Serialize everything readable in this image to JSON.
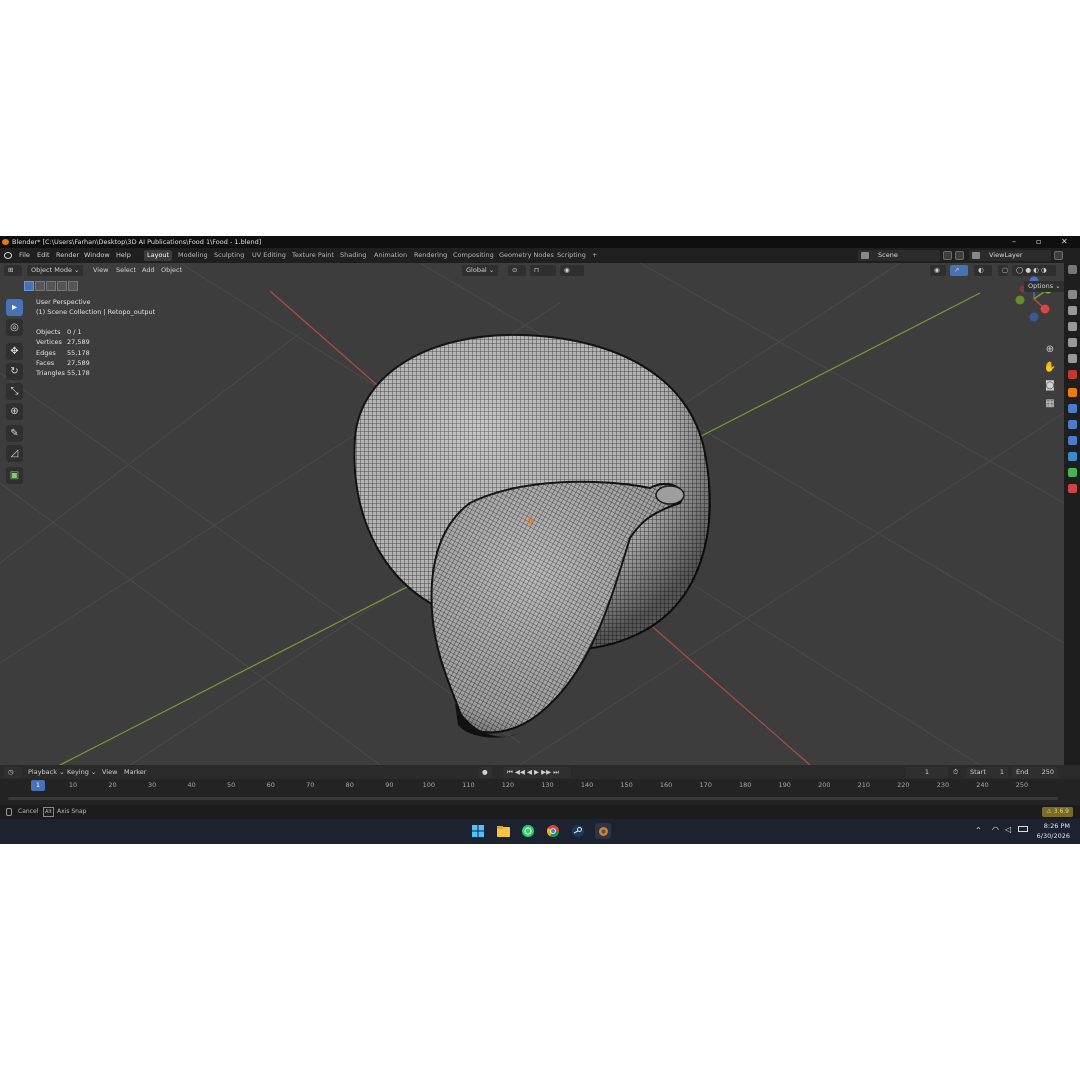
{
  "window": {
    "title": "Blender* [C:\\Users\\Farhan\\Desktop\\3D AI Publications\\Food 1\\Food - 1.blend]"
  },
  "menu": {
    "items": [
      "File",
      "Edit",
      "Render",
      "Window",
      "Help"
    ]
  },
  "workspaces": [
    "Layout",
    "Modeling",
    "Sculpting",
    "UV Editing",
    "Texture Paint",
    "Shading",
    "Animation",
    "Rendering",
    "Compositing",
    "Geometry Nodes",
    "Scripting",
    "+"
  ],
  "scene": {
    "scene_name": "Scene",
    "view_layer": "ViewLayer"
  },
  "viewport_header": {
    "mode": "Object Mode",
    "menus": [
      "View",
      "Select",
      "Add",
      "Object"
    ],
    "orientation": "Global",
    "options": "Options"
  },
  "overlay": {
    "perspective": "User Perspective",
    "collection": "(1) Scene Collection | Retopo_output"
  },
  "stats": [
    {
      "label": "Objects",
      "value": "0 / 1"
    },
    {
      "label": "Vertices",
      "value": "27,589"
    },
    {
      "label": "Edges",
      "value": "55,178"
    },
    {
      "label": "Faces",
      "value": "27,589"
    },
    {
      "label": "Triangles",
      "value": "55,178"
    }
  ],
  "timeline": {
    "menus": [
      "Playback",
      "Keying",
      "View",
      "Marker"
    ],
    "current_frame": "1",
    "frame_field": "1",
    "start_label": "Start",
    "start": "1",
    "end_label": "End",
    "end": "250",
    "ticks": [
      "10",
      "20",
      "30",
      "40",
      "50",
      "60",
      "70",
      "80",
      "90",
      "100",
      "110",
      "120",
      "130",
      "140",
      "150",
      "160",
      "170",
      "180",
      "190",
      "200",
      "210",
      "220",
      "230",
      "240",
      "250"
    ]
  },
  "statusbar": {
    "cancel": "Cancel",
    "axis_snap": "Axis Snap",
    "alt_key": "Alt",
    "version": "3.6.9"
  },
  "taskbar": {
    "time": "8:26 PM",
    "date": "6/30/2026"
  },
  "colors": {
    "accent": "#4772b3",
    "x_axis": "#b34a4a",
    "y_axis": "#7a9a2e",
    "viewport_bg": "#3d3d3d",
    "blender_orange": "#e87d0d"
  }
}
